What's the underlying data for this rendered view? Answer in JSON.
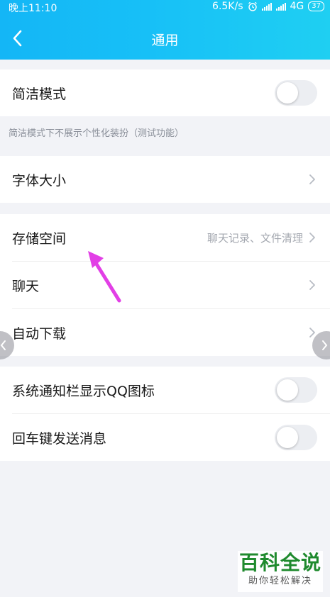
{
  "status_bar": {
    "time": "晚上11:10",
    "speed": "6.5K/s",
    "network": "4G",
    "battery": "37"
  },
  "nav": {
    "title": "通用",
    "back_icon": "chevron-left-icon"
  },
  "simple_mode": {
    "label": "简洁模式",
    "enabled": false,
    "hint": "简洁模式下不展示个性化装扮（测试功能）"
  },
  "font_size": {
    "label": "字体大小"
  },
  "storage_group": {
    "items": [
      {
        "label": "存储空间",
        "value": "聊天记录、文件清理"
      },
      {
        "label": "聊天",
        "value": ""
      },
      {
        "label": "自动下载",
        "value": ""
      }
    ]
  },
  "notification_group": {
    "items": [
      {
        "label": "系统通知栏显示QQ图标",
        "enabled": false
      },
      {
        "label": "回车键发送消息",
        "enabled": false
      }
    ]
  },
  "watermark": {
    "title": "百科全说",
    "subtitle": "助你轻松解决"
  },
  "colors": {
    "header_start": "#14b6f6",
    "header_end": "#1fcff2",
    "annotation_arrow": "#e23fe6",
    "watermark_green": "#1f8a2e"
  }
}
